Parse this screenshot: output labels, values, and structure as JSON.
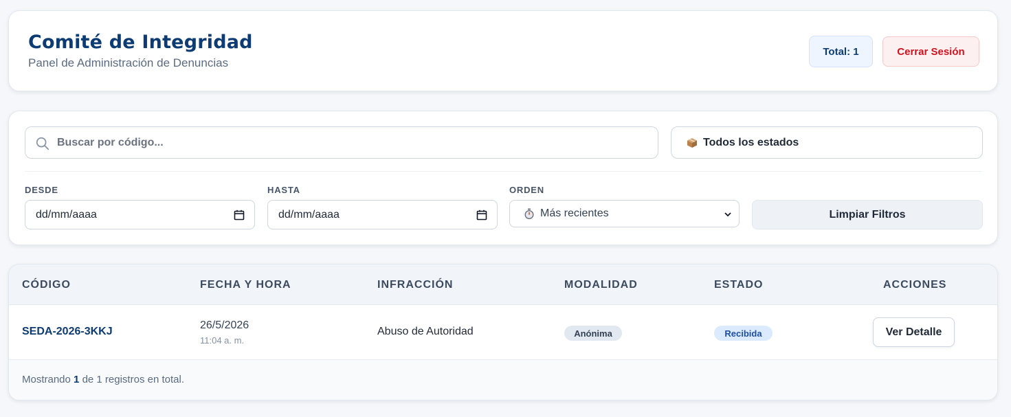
{
  "header": {
    "title": "Comité de Integridad",
    "subtitle": "Panel de Administración de Denuncias",
    "total_label": "Total: 1",
    "logout_label": "Cerrar Sesión"
  },
  "filters": {
    "search_placeholder": "Buscar por código...",
    "search_value": "",
    "status_label": "Todos los estados",
    "from_label": "DESDE",
    "from_value": "dd/mm/aaaa",
    "to_label": "HASTA",
    "to_value": "dd/mm/aaaa",
    "order_label": "ORDEN",
    "order_value": "Más recientes",
    "clear_label": "Limpiar Filtros"
  },
  "table": {
    "columns": [
      "CÓDIGO",
      "FECHA Y HORA",
      "INFRACCIÓN",
      "MODALIDAD",
      "ESTADO",
      "ACCIONES"
    ],
    "rows": [
      {
        "code": "SEDA-2026-3KKJ",
        "date": "26/5/2026",
        "time": "11:04 a. m.",
        "infraction": "Abuso de Autoridad",
        "modality": "Anónima",
        "status": "Recibida",
        "action": "Ver Detalle"
      }
    ],
    "footer": {
      "prefix": "Mostrando",
      "shown": "1",
      "suffix": "de 1 registros en total."
    }
  },
  "colors": {
    "brand": "#0d3b73",
    "danger": "#d1121e",
    "badge_blue": "#dbeafe",
    "page_bg": "#f5f7fa"
  },
  "icons": {
    "search": "search-icon",
    "status": "package-icon",
    "date": "calendar-icon",
    "order": "stopwatch-icon",
    "select": "chevron-down-icon"
  }
}
